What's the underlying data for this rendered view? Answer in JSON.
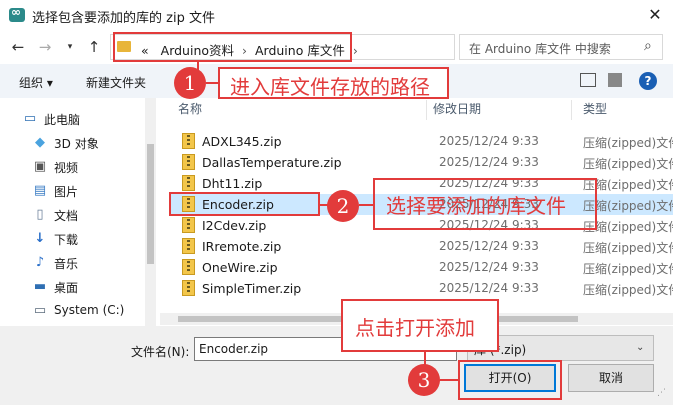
{
  "window": {
    "title": "选择包含要添加的库的 zip 文件",
    "close_label": "✕"
  },
  "address": {
    "overflow": "«",
    "crumbs": [
      "Arduino资料",
      "Arduino 库文件"
    ],
    "sep": "›"
  },
  "search": {
    "placeholder": "在 Arduino 库文件 中搜索"
  },
  "toolbar": {
    "organize": "组织 ▾",
    "new_folder": "新建文件夹",
    "help": "?"
  },
  "sidebar": {
    "items": [
      {
        "label": "此电脑",
        "icon": "computer-icon"
      },
      {
        "label": "3D 对象",
        "icon": "cube-icon"
      },
      {
        "label": "视频",
        "icon": "video-icon"
      },
      {
        "label": "图片",
        "icon": "picture-icon"
      },
      {
        "label": "文档",
        "icon": "document-icon"
      },
      {
        "label": "下载",
        "icon": "download-icon"
      },
      {
        "label": "音乐",
        "icon": "music-icon"
      },
      {
        "label": "桌面",
        "icon": "desktop-icon"
      },
      {
        "label": "System (C:)",
        "icon": "drive-icon"
      }
    ]
  },
  "columns": {
    "name": "名称",
    "date": "修改日期",
    "type": "类型"
  },
  "files": [
    {
      "name": "ADXL345.zip",
      "date": "2025/12/24 9:33",
      "type": "压缩(zipped)文件"
    },
    {
      "name": "DallasTemperature.zip",
      "date": "2025/12/24 9:33",
      "type": "压缩(zipped)文件"
    },
    {
      "name": "Dht11.zip",
      "date": "2025/12/24 9:33",
      "type": "压缩(zipped)文件"
    },
    {
      "name": "Encoder.zip",
      "date": "2025/12/24 9:33",
      "type": "压缩(zipped)文件",
      "selected": true
    },
    {
      "name": "I2Cdev.zip",
      "date": "2025/12/24 9:33",
      "type": "压缩(zipped)文件"
    },
    {
      "name": "IRremote.zip",
      "date": "2025/12/24 9:33",
      "type": "压缩(zipped)文件"
    },
    {
      "name": "OneWire.zip",
      "date": "2025/12/24 9:33",
      "type": "压缩(zipped)文件"
    },
    {
      "name": "SimpleTimer.zip",
      "date": "2025/12/24 9:33",
      "type": "压缩(zipped)文件"
    }
  ],
  "footer": {
    "filename_label": "文件名(N):",
    "filename_value": "Encoder.zip",
    "filter_value": "库 (*.zip)",
    "open_label": "打开(O)",
    "cancel_label": "取消"
  },
  "annotations": {
    "step1_number": "1",
    "step1_text": "进入库文件存放的路径",
    "step2_number": "2",
    "step2_text": "选择要添加的库文件",
    "step3_number": "3",
    "step3_text": "点击打开添加",
    "color": "#e23b3b"
  }
}
